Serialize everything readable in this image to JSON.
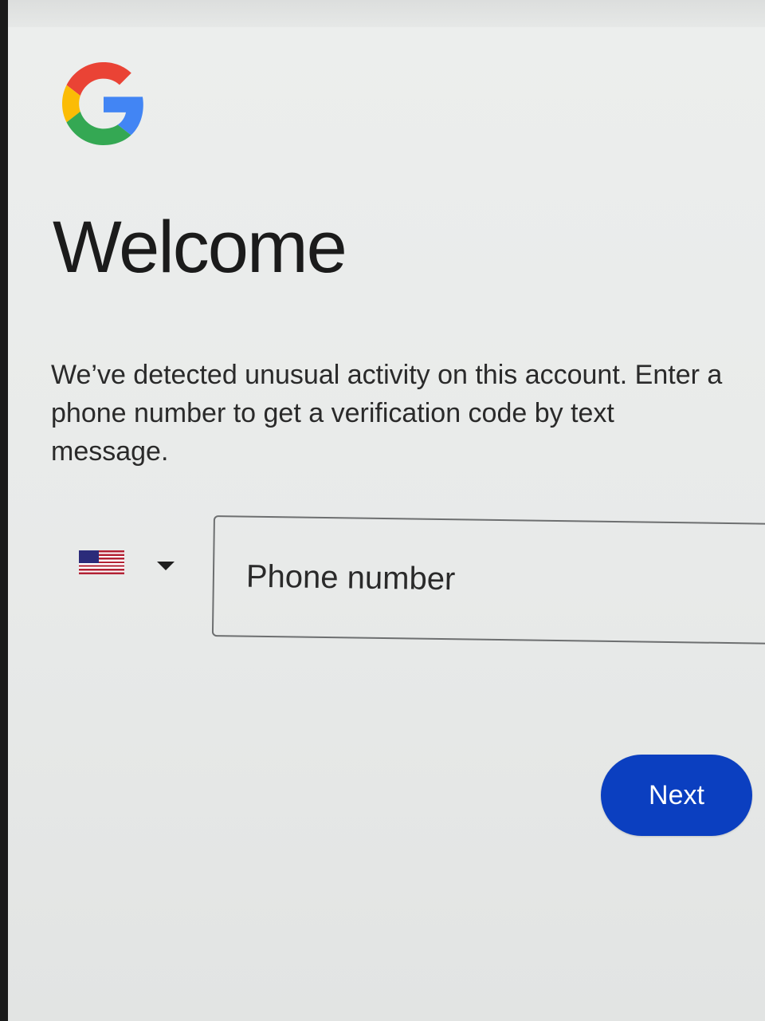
{
  "header": {
    "logo_icon": "google-g-logo-icon"
  },
  "main": {
    "title": "Welcome",
    "description_lines": [
      "We’ve detected unusual activity on this account. Enter a",
      "phone number to get a verification code by text",
      "message."
    ]
  },
  "phone": {
    "country_icon": "us-flag-icon",
    "dropdown_icon": "caret-down-icon",
    "placeholder": "Phone number",
    "value": ""
  },
  "actions": {
    "next_label": "Next"
  },
  "colors": {
    "primary_button": "#0b3fc0",
    "google_blue": "#4285F4",
    "google_red": "#EA4335",
    "google_yellow": "#FBBC05",
    "google_green": "#34A853"
  }
}
